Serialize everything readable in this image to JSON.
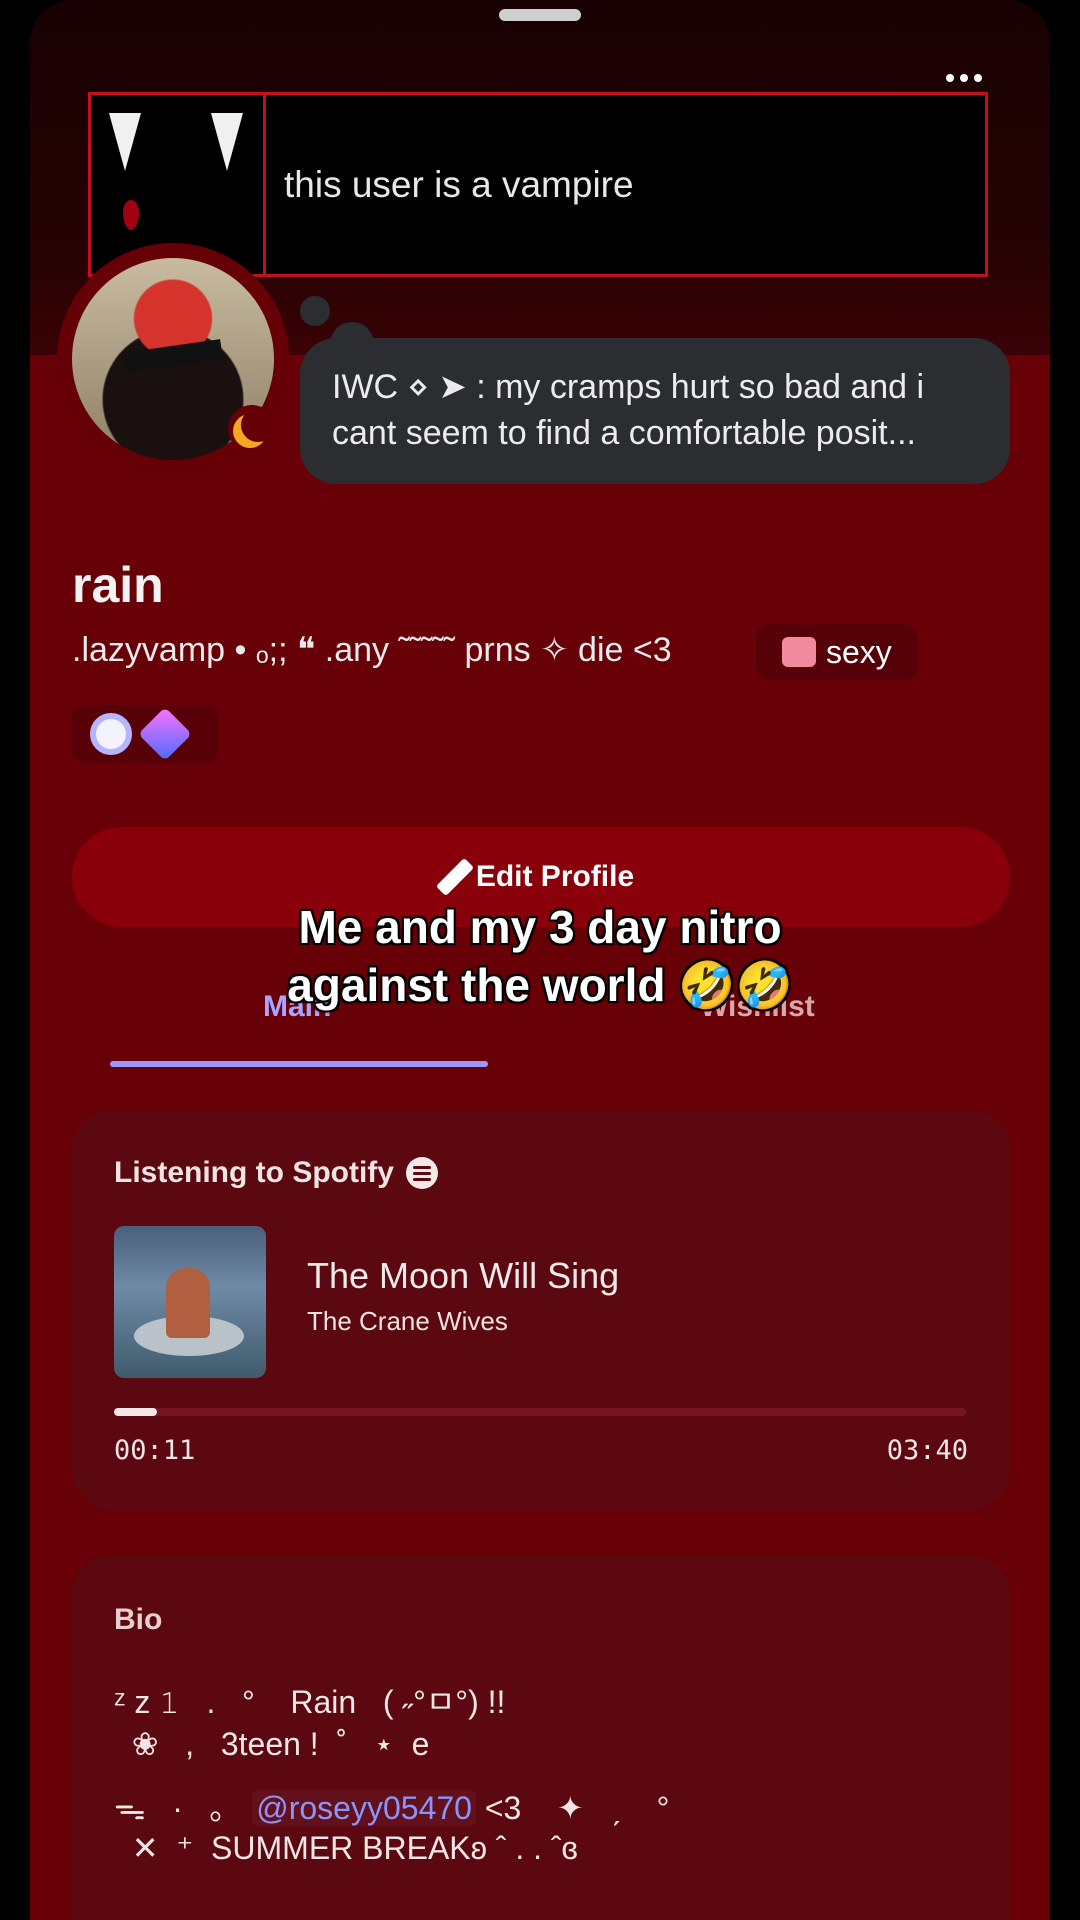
{
  "banner": {
    "stamp_text": "this user is a vampire"
  },
  "status": {
    "text_line1": "IWC ⋄ ➤ : my cramps hurt so bad and i",
    "text_line2": "cant seem to find a comfortable posit..."
  },
  "profile": {
    "display_name": "rain",
    "subtitle": ".lazyvamp • ₒ;; ❝ .any ˜˜˜˜˜ prns ✧ die <3",
    "clan_tag": "sexy",
    "edit_button_label": "Edit Profile"
  },
  "tabs": {
    "main_label": "Main",
    "wishlist_label": "Wishlist"
  },
  "caption": {
    "line1": "Me and my 3 day nitro",
    "line2": "against the world 🤣🤣"
  },
  "spotify": {
    "heading": "Listening to Spotify",
    "track_title": "The Moon Will Sing",
    "artist": "The Crane Wives",
    "elapsed": "00:11",
    "duration": "03:40",
    "progress": 0.05
  },
  "bio": {
    "heading": "Bio",
    "line1": "ᶻ z 𝟷   .   °    Rain   ( ˶°ㅁ°) !!",
    "line2": "  ❀   ,   3teen !  ˚   ⋆  e",
    "line3_prefix": "ᯓ   ·   ｡   ",
    "line3_mention": "@roseyy05470",
    "line3_suffix": " <3    ✦   ˏ    °",
    "line4": "  ✕  ⁺  SUMMER BREAKʚ ˆ . . ˆɞ"
  },
  "colors": {
    "profile_bg": "#680007",
    "accent": "#9c95ff",
    "button": "#8a000a",
    "card": "#5c0811"
  }
}
